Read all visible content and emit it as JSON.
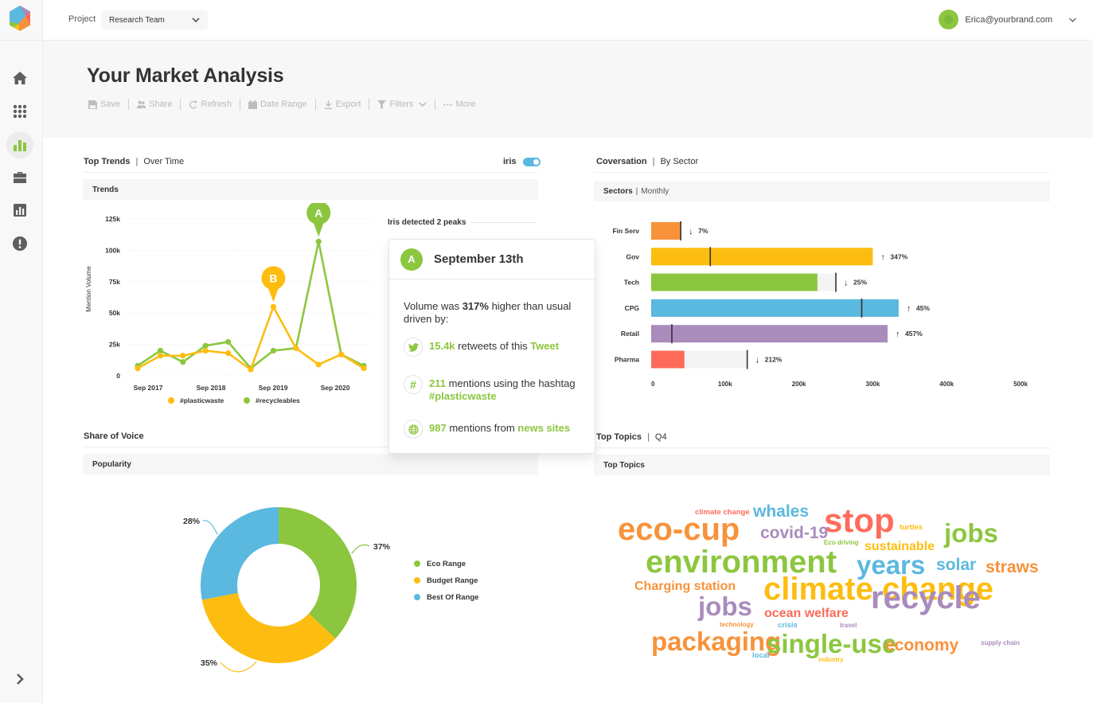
{
  "app": {
    "project_label": "Project",
    "project_value": "Research Team",
    "user_email": "Erica@yourbrand.com",
    "brand_colors": {
      "green": "#8cc63f",
      "yellow": "#fdbd10",
      "blue": "#5bb8df",
      "orange": "#f7923a",
      "purple": "#a98bbc",
      "red": "#fe6b5b"
    }
  },
  "sidebar": {
    "items": [
      {
        "name": "home",
        "icon": "home-icon",
        "active": false
      },
      {
        "name": "apps",
        "icon": "grid-icon",
        "active": false
      },
      {
        "name": "analytics",
        "icon": "bar-chart-icon",
        "active": true
      },
      {
        "name": "portfolio",
        "icon": "briefcase-icon",
        "active": false
      },
      {
        "name": "reports",
        "icon": "report-icon",
        "active": false
      },
      {
        "name": "alerts",
        "icon": "alert-icon",
        "active": false
      }
    ],
    "expand_icon": "chevron-right-icon"
  },
  "header": {
    "title": "Your Market Analysis",
    "toolbar": [
      {
        "label": "Save",
        "icon": "save-icon"
      },
      {
        "label": "Share",
        "icon": "users-icon"
      },
      {
        "label": "Refresh",
        "icon": "refresh-icon"
      },
      {
        "label": "Date Range",
        "icon": "calendar-icon"
      },
      {
        "label": "Export",
        "icon": "download-icon"
      },
      {
        "label": "Filters",
        "icon": "filter-icon"
      },
      {
        "label": "More",
        "icon": "more-icon"
      }
    ]
  },
  "trends": {
    "title": "Top Trends",
    "subtitle": "Over Time",
    "toggle_label": "iris",
    "toggle_on": true,
    "subhead": "Trends",
    "iris_label": "Iris detected 2 peaks"
  },
  "popup": {
    "badge": "A",
    "date": "September 13th",
    "summary_prefix": "Volume was ",
    "summary_bold": "317%",
    "summary_suffix": " higher than usual driven by:",
    "items": [
      {
        "icon": "twitter-icon",
        "highlight": "15.4k",
        "text": " retweets of this ",
        "link": "Tweet"
      },
      {
        "icon": "hashtag-icon",
        "highlight": "211",
        "text": " mentions using the hashtag ",
        "link": "#plasticwaste"
      },
      {
        "icon": "globe-icon",
        "highlight": "987",
        "text": " mentions from ",
        "link": "news sites"
      }
    ]
  },
  "sectors": {
    "title": "Coversation",
    "subtitle": "By Sector",
    "subhead": "Sectors",
    "subhead_light": "Monthly"
  },
  "share": {
    "title": "Share of Voice",
    "subhead": "Popularity"
  },
  "topics": {
    "title": "Top Topics",
    "subtitle": "Q4",
    "subhead": "Top Topics",
    "words": [
      {
        "text": "climate change",
        "color": "#fe6b5b",
        "size": "xs"
      },
      {
        "text": "whales",
        "color": "#5bb8df",
        "size": "m"
      },
      {
        "text": "stop",
        "color": "#fe6b5b",
        "size": "xl"
      },
      {
        "text": "turtles",
        "color": "#fdbd10",
        "size": "xs"
      },
      {
        "text": "jobs",
        "color": "#8cc63f",
        "size": "l"
      },
      {
        "text": "eco-cup",
        "color": "#f7923a",
        "size": "xl"
      },
      {
        "text": "covid-19",
        "color": "#a98bbc",
        "size": "m"
      },
      {
        "text": "Eco driving",
        "color": "#8cc63f",
        "size": "xxs"
      },
      {
        "text": "sustainable",
        "color": "#fdbd10",
        "size": "s"
      },
      {
        "text": "environment",
        "color": "#8cc63f",
        "size": "xl"
      },
      {
        "text": "years",
        "color": "#5bb8df",
        "size": "l"
      },
      {
        "text": "solar",
        "color": "#5bb8df",
        "size": "m"
      },
      {
        "text": "straws",
        "color": "#f7923a",
        "size": "m"
      },
      {
        "text": "Charging station",
        "color": "#f7923a",
        "size": "s"
      },
      {
        "text": "climate change",
        "color": "#fdbd10",
        "size": "xl"
      },
      {
        "text": "jobs",
        "color": "#a98bbc",
        "size": "m"
      },
      {
        "text": "ocean welfare",
        "color": "#fe6b5b",
        "size": "s"
      },
      {
        "text": "recycle",
        "color": "#a98bbc",
        "size": "xl"
      },
      {
        "text": "technology",
        "color": "#f7923a",
        "size": "xxs"
      },
      {
        "text": "crisis",
        "color": "#5bb8df",
        "size": "xs"
      },
      {
        "text": "travel",
        "color": "#a98bbc",
        "size": "xxs"
      },
      {
        "text": "packaging",
        "color": "#f7923a",
        "size": "l"
      },
      {
        "text": "single-use",
        "color": "#8cc63f",
        "size": "l"
      },
      {
        "text": "economy",
        "color": "#f7923a",
        "size": "m"
      },
      {
        "text": "supply chain",
        "color": "#a98bbc",
        "size": "xxs"
      },
      {
        "text": "local",
        "color": "#5bb8df",
        "size": "xs"
      },
      {
        "text": "industry",
        "color": "#fdbd10",
        "size": "xxs"
      }
    ]
  },
  "chart_data": [
    {
      "type": "line",
      "title": "Trends",
      "xlabel": "",
      "ylabel": "Mention Volume",
      "ylim": [
        0,
        125000
      ],
      "yticks": [
        "0",
        "25k",
        "50k",
        "75k",
        "100k",
        "125k"
      ],
      "xtick_labels": [
        "Sep 2017",
        "Sep 2018",
        "Sep 2019",
        "Sep 2020"
      ],
      "grid": true,
      "legend": "bottom",
      "series": [
        {
          "name": "#plasticwaste",
          "color": "#fdbd10",
          "values": [
            6000,
            16000,
            16000,
            20000,
            18000,
            5000,
            55000,
            22000,
            9000,
            17000,
            6000
          ]
        },
        {
          "name": "#recycleables",
          "color": "#8cc63f",
          "values": [
            8000,
            20000,
            11000,
            24000,
            27000,
            6000,
            20000,
            22000,
            107000,
            17000,
            8000
          ]
        }
      ],
      "annotations": [
        {
          "label": "A",
          "series": "#recycleables",
          "index": 8,
          "color": "#8cc63f"
        },
        {
          "label": "B",
          "series": "#plasticwaste",
          "index": 6,
          "color": "#fdbd10"
        }
      ]
    },
    {
      "type": "bar",
      "orientation": "horizontal",
      "title": "Sectors | Monthly",
      "xlim": [
        0,
        500000
      ],
      "xticks": [
        "0",
        "100k",
        "200k",
        "300k",
        "400k",
        "500k"
      ],
      "categories": [
        "Fin Serv",
        "Gov",
        "Tech",
        "CPG",
        "Retail",
        "Pharma"
      ],
      "values": [
        40000,
        300000,
        225000,
        335000,
        320000,
        45000
      ],
      "previous": [
        40000,
        80000,
        250000,
        285000,
        28000,
        130000
      ],
      "changes": [
        {
          "dir": "down",
          "label": "7%"
        },
        {
          "dir": "up",
          "label": "347%"
        },
        {
          "dir": "down",
          "label": "25%"
        },
        {
          "dir": "up",
          "label": "45%"
        },
        {
          "dir": "up",
          "label": "457%"
        },
        {
          "dir": "down",
          "label": "212%"
        }
      ],
      "colors": [
        "#f7923a",
        "#fdbd10",
        "#8cc63f",
        "#5bb8df",
        "#a98bbc",
        "#fe6b5b"
      ]
    },
    {
      "type": "pie",
      "title": "Popularity",
      "donut": true,
      "legend": "right",
      "slices": [
        {
          "label": "Eco Range",
          "value": 37,
          "display": "37%",
          "color": "#8cc63f"
        },
        {
          "label": "Budget Range",
          "value": 35,
          "display": "35%",
          "color": "#fdbd10"
        },
        {
          "label": "Best Of Range",
          "value": 28,
          "display": "28%",
          "color": "#5bb8df"
        }
      ]
    }
  ]
}
